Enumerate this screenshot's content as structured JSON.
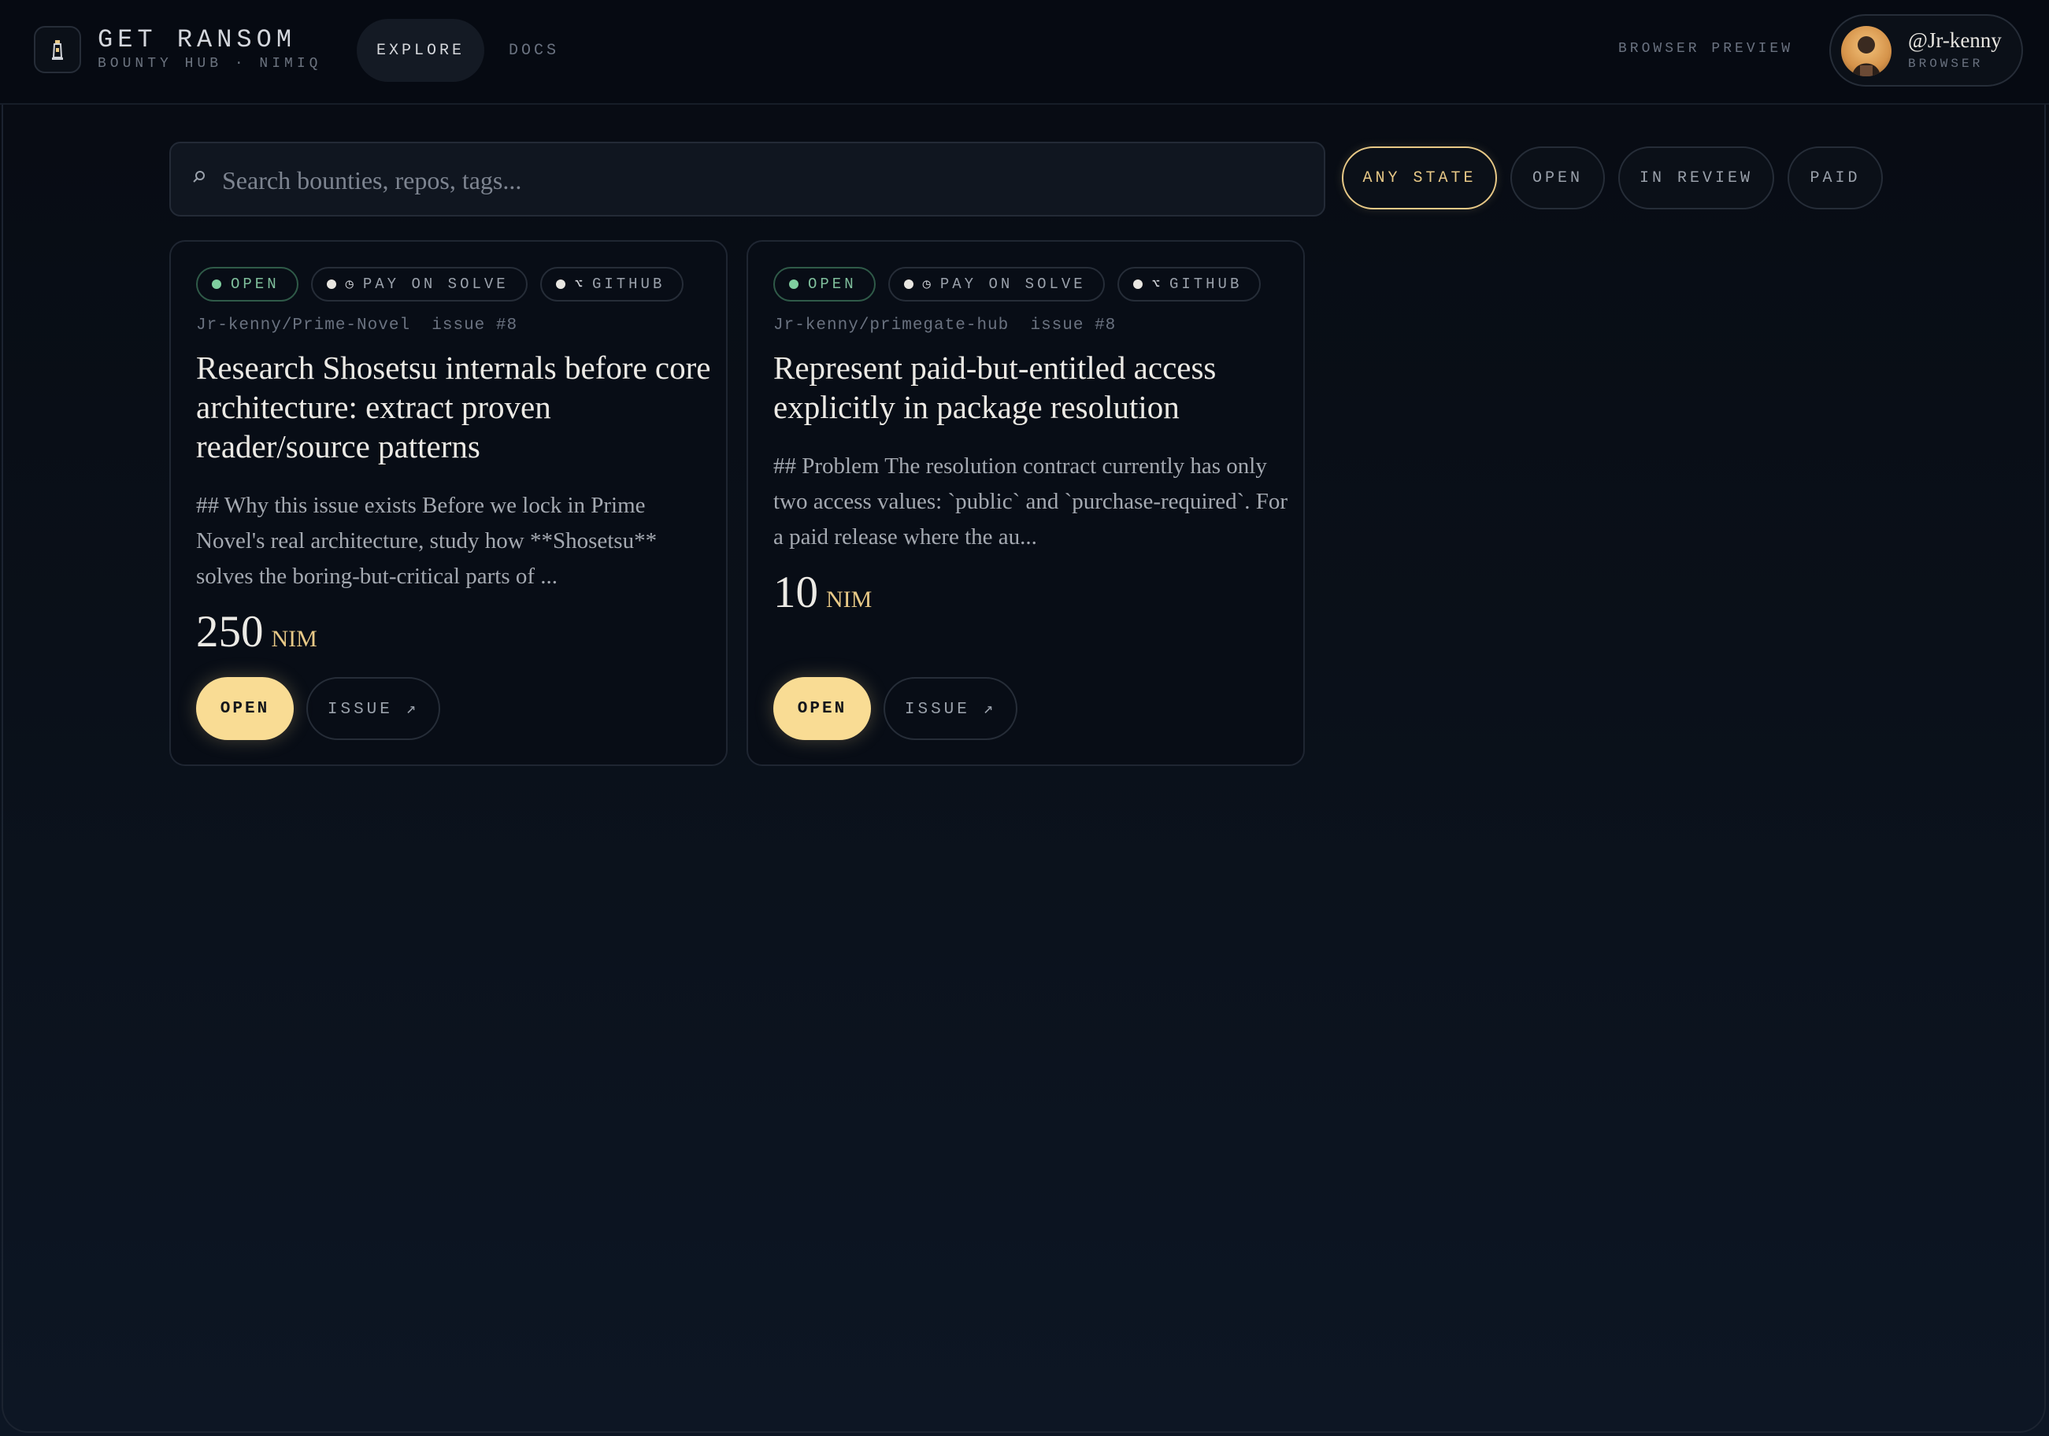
{
  "header": {
    "brand_title": "GET RANSOM",
    "brand_subtitle": "BOUNTY HUB · NIMIQ",
    "nav": {
      "explore": "EXPLORE",
      "docs": "DOCS"
    },
    "browser_preview": "BROWSER PREVIEW",
    "user": {
      "name": "@Jr-kenny",
      "role": "BROWSER"
    }
  },
  "search": {
    "placeholder": "Search bounties, repos, tags...",
    "value": ""
  },
  "filters": [
    "ANY STATE",
    "OPEN",
    "IN REVIEW",
    "PAID"
  ],
  "active_filter": "ANY STATE",
  "cards": [
    {
      "status": "OPEN",
      "payout": "PAY ON SOLVE",
      "source": "GITHUB",
      "repo": "Jr-kenny/Prime-Novel",
      "issue": "issue #8",
      "title": "Research Shosetsu internals before core architecture: extract proven reader/source patterns",
      "description": "## Why this issue exists Before we lock in Prime Novel's real architecture, study how **Shosetsu** solves the boring-but-critical parts of ...",
      "amount": "250",
      "unit": "NIM",
      "open_label": "OPEN",
      "issue_label": "ISSUE ↗"
    },
    {
      "status": "OPEN",
      "payout": "PAY ON SOLVE",
      "source": "GITHUB",
      "repo": "Jr-kenny/primegate-hub",
      "issue": "issue #8",
      "title": "Represent paid-but-entitled access explicitly in package resolution",
      "description": "## Problem The resolution contract currently has only two access values: `public` and `purchase-required`. For a paid release where the au...",
      "amount": "10",
      "unit": "NIM",
      "open_label": "OPEN",
      "issue_label": "ISSUE ↗"
    }
  ],
  "colors": {
    "accent": "#f9dc94",
    "accent_text": "#e8c987",
    "status_open": "#7fcf9f",
    "background": "#070b13"
  },
  "icons": {
    "logo": "lighthouse-icon",
    "search": "search-icon",
    "payout": "clock-icon",
    "source": "branch-icon",
    "external": "arrow-up-right-icon"
  }
}
